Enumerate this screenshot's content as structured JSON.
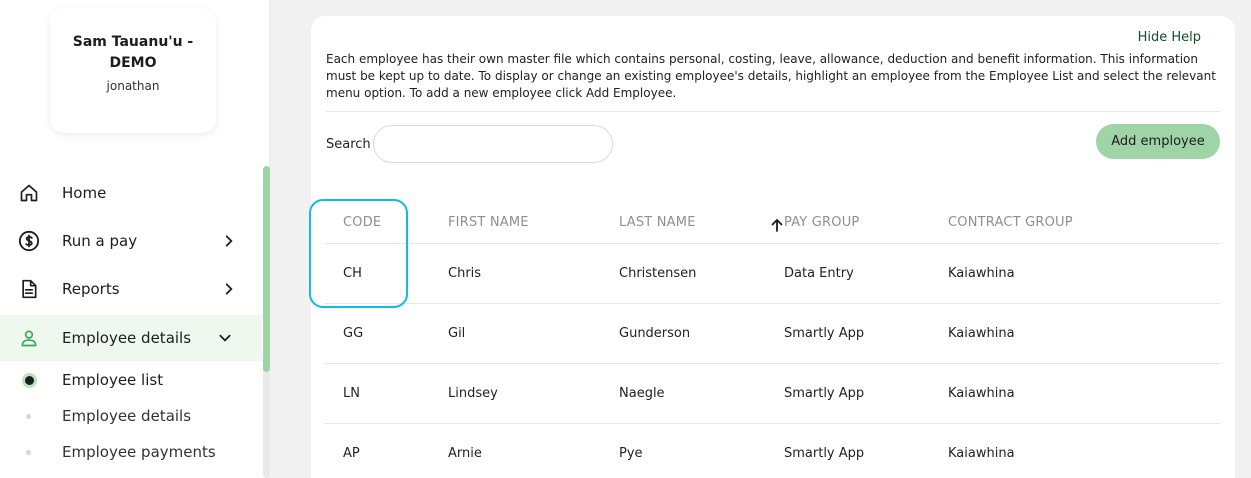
{
  "profile": {
    "name": "Sam Tauanu'u - DEMO",
    "username": "jonathan"
  },
  "nav": [
    {
      "label": "Home",
      "icon": "home-icon",
      "has_chevron": false
    },
    {
      "label": "Run a pay",
      "icon": "dollar-circle-icon",
      "has_chevron": true
    },
    {
      "label": "Reports",
      "icon": "document-icon",
      "has_chevron": true
    },
    {
      "label": "Employee details",
      "icon": "person-icon",
      "has_chevron": true,
      "active": true
    }
  ],
  "subnav": [
    {
      "label": "Employee list",
      "current": true
    },
    {
      "label": "Employee details",
      "current": false
    },
    {
      "label": "Employee payments",
      "current": false
    }
  ],
  "help": {
    "hide_label": "Hide Help",
    "text": "Each employee has their own master file which contains personal, costing, leave, allowance, deduction and benefit information. This information must be kept up to date. To display or change an existing employee's details, highlight an employee from the Employee List and select the relevant menu option. To add a new employee click Add Employee."
  },
  "search": {
    "label": "Search",
    "value": "",
    "placeholder": ""
  },
  "add_button_label": "Add employee",
  "table": {
    "columns": [
      "CODE",
      "FIRST NAME",
      "LAST NAME",
      "PAY GROUP",
      "CONTRACT GROUP"
    ],
    "sorted_column": "PAY GROUP",
    "sort_direction": "ascending",
    "rows": [
      [
        "CH",
        "Chris",
        "Christensen",
        "Data Entry",
        "Kaiawhina"
      ],
      [
        "GG",
        "Gil",
        "Gunderson",
        "Smartly App",
        "Kaiawhina"
      ],
      [
        "LN",
        "Lindsey",
        "Naegle",
        "Smartly App",
        "Kaiawhina"
      ],
      [
        "AP",
        "Arnie",
        "Pye",
        "Smartly App",
        "Kaiawhina"
      ]
    ]
  },
  "colors": {
    "accent_green": "#9fd4a6",
    "active_bg": "#eef8ef",
    "focus_ring": "#14b9e6"
  }
}
